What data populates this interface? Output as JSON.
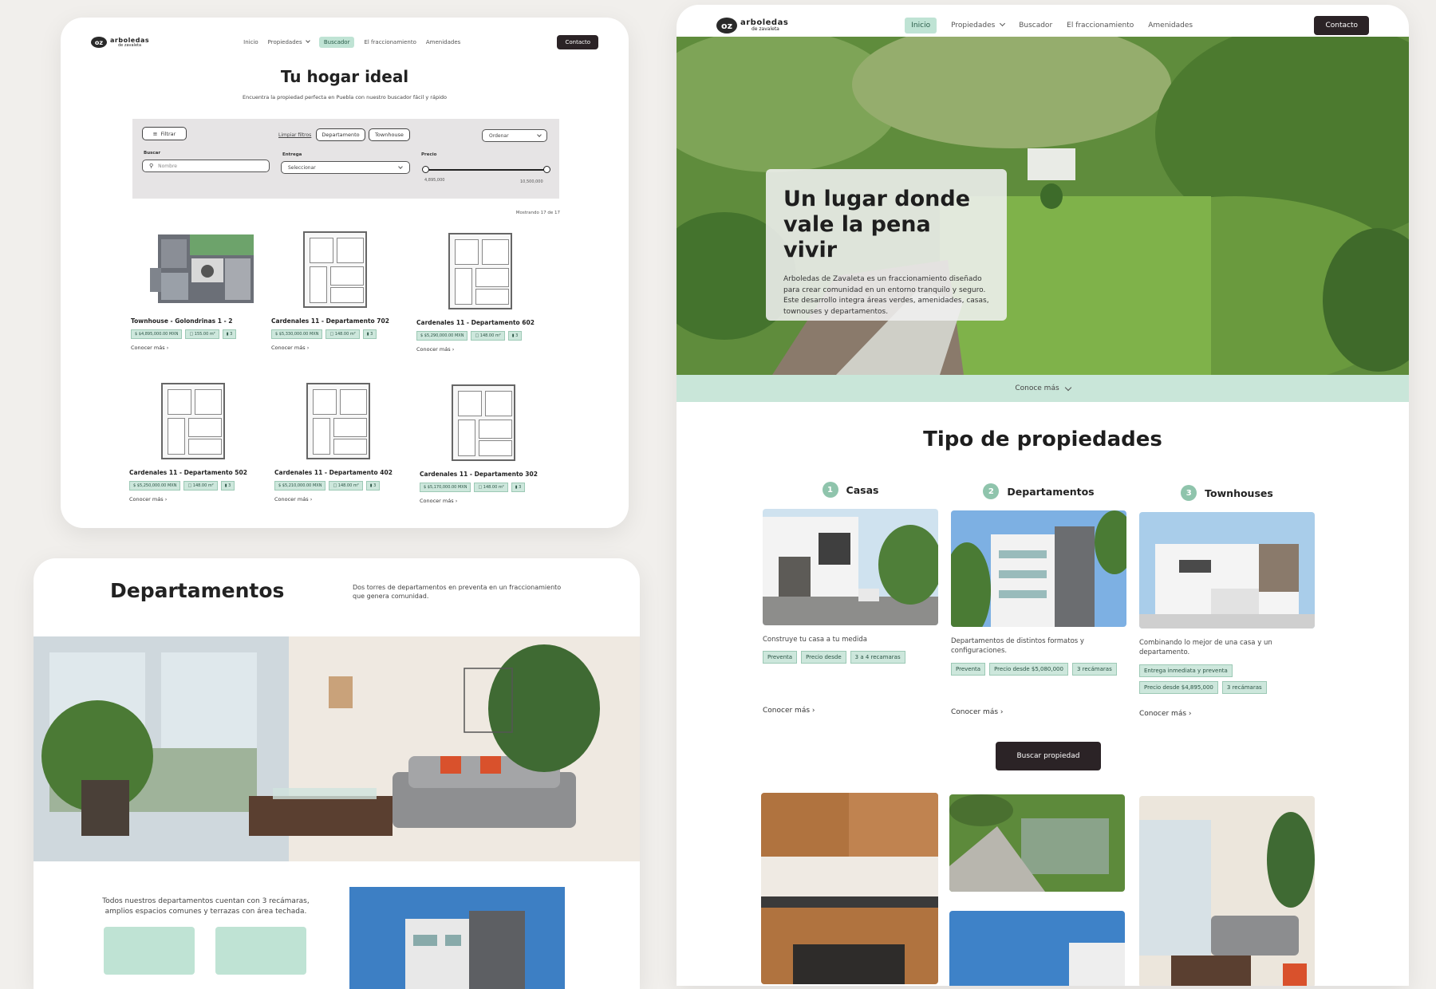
{
  "brand": {
    "mark": "oz",
    "line1": "arboledas",
    "line2": "de zavaleta"
  },
  "search_page": {
    "nav": {
      "items": [
        "Inicio",
        "Propiedades",
        "Buscador",
        "El fraccionamiento",
        "Amenidades"
      ],
      "active": "Buscador",
      "contact": "Contacto"
    },
    "title": "Tu hogar ideal",
    "subtitle": "Encuentra la propiedad perfecta en Puebla con nuestro buscador fácil y rápido",
    "filters": {
      "filter_button": "Filtrar",
      "clear_link": "Limpiar filtros",
      "chip_1": "Departamento",
      "chip_2": "Townhouse",
      "sort_value": "Ordenar",
      "search_label": "Buscar",
      "search_placeholder": "Nombre",
      "delivery_label": "Entrega",
      "delivery_value": "Seleccionar",
      "price_label": "Precio",
      "price_min": "4,895,000",
      "price_max": "10,500,000"
    },
    "showing": "Mostrando 17 de 17",
    "properties": [
      {
        "name": "Townhouse - Golondrinas 1 - 2",
        "price": "$4,895,000.00 MXN",
        "area": "155.00 m²",
        "beds": "3",
        "more": "Conocer más"
      },
      {
        "name": "Cardenales 11 - Departamento 702",
        "price": "$5,330,000.00 MXN",
        "area": "148.00 m²",
        "beds": "3",
        "more": "Conocer más"
      },
      {
        "name": "Cardenales 11 - Departamento 602",
        "price": "$5,290,000.00 MXN",
        "area": "148.00 m²",
        "beds": "3",
        "more": "Conocer más"
      },
      {
        "name": "Cardenales 11 - Departamento 502",
        "price": "$5,250,000.00 MXN",
        "area": "148.00 m²",
        "beds": "3",
        "more": "Conocer más"
      },
      {
        "name": "Cardenales 11 - Departamento 402",
        "price": "$5,210,000.00 MXN",
        "area": "148.00 m²",
        "beds": "3",
        "more": "Conocer más"
      },
      {
        "name": "Cardenales 11 - Departamento 302",
        "price": "$5,170,000.00 MXN",
        "area": "148.00 m²",
        "beds": "3",
        "more": "Conocer más"
      }
    ]
  },
  "departments_page": {
    "title": "Departamentos",
    "description": "Dos torres de departamentos en preventa en un fraccionamiento que genera comunidad.",
    "body": "Todos nuestros departamentos cuentan con 3 recámaras, amplios espacios comunes y terrazas con área techada."
  },
  "home_page": {
    "nav": {
      "items": [
        "Inicio",
        "Propiedades",
        "Buscador",
        "El fraccionamiento",
        "Amenidades"
      ],
      "active": "Inicio",
      "contact": "Contacto"
    },
    "hero": {
      "title": "Un lugar donde vale la pena vivir",
      "text": "Arboledas de Zavaleta es un fraccionamiento diseñado para crear comunidad en un entorno tranquilo y seguro. Este desarrollo integra áreas verdes, amenidades, casas, townouses y departamentos."
    },
    "conoce": "Conoce más",
    "section_title": "Tipo de propiedades",
    "types": [
      {
        "num": "1",
        "name": "Casas",
        "desc": "Construye tu casa a tu medida",
        "tags": [
          "Preventa",
          "Precio desde",
          "3 a 4 recamaras"
        ],
        "more": "Conocer más"
      },
      {
        "num": "2",
        "name": "Departamentos",
        "desc": "Departamentos de distintos formatos y configuraciones.",
        "tags": [
          "Preventa",
          "Precio desde $5,080,000",
          "3 recámaras"
        ],
        "more": "Conocer más"
      },
      {
        "num": "3",
        "name": "Townhouses",
        "desc": "Combinando lo mejor de una casa y un departamento.",
        "tags": [
          "Entrega inmediata y preventa",
          "Precio desde $4,895,000",
          "3 recámaras"
        ],
        "more": "Conocer más"
      }
    ],
    "search_button": "Buscar propiedad"
  },
  "colors": {
    "accent": "#bfe3d4",
    "accent_dark": "#2c5546",
    "dark": "#2b2326",
    "background": "#f1efec"
  }
}
